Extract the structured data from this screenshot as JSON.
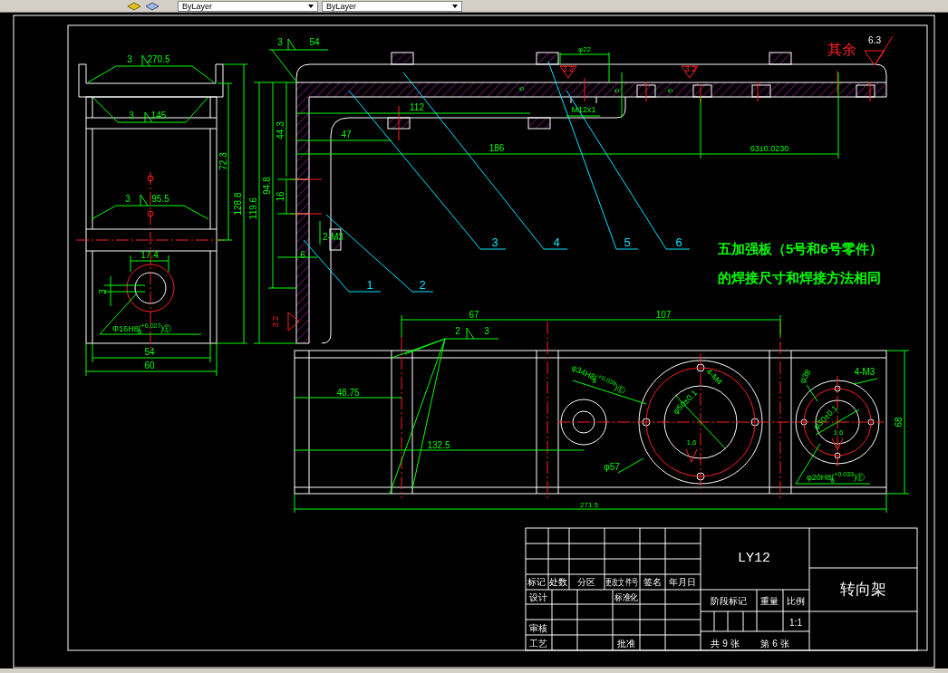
{
  "toolbar": {
    "dropdowns": [
      "ByLayer",
      "ByLayer"
    ]
  },
  "side_view": {
    "labels": [
      {
        "text": "3",
        "kind": "dimension"
      },
      {
        "text": "270.5",
        "kind": "dimension"
      },
      {
        "text": "3",
        "kind": "dimension"
      },
      {
        "text": "145",
        "kind": "dimension"
      },
      {
        "text": "3",
        "kind": "dimension"
      },
      {
        "text": "95.5",
        "kind": "dimension"
      },
      {
        "text": "72.3",
        "kind": "dimension"
      },
      {
        "text": "128.8",
        "kind": "dimension"
      },
      {
        "text": "17.4",
        "kind": "dimension"
      },
      {
        "text": "3",
        "kind": "dimension"
      },
      {
        "text": "Φ16H8(",
        "upper": "+0.027",
        "lower": "0",
        "suffix": ")Ⓔ",
        "kind": "dimension"
      },
      {
        "text": "54",
        "kind": "dimension"
      },
      {
        "text": "60",
        "kind": "dimension"
      }
    ]
  },
  "front_view": {
    "labels": [
      {
        "text": "3",
        "kind": "dimension"
      },
      {
        "text": "54",
        "kind": "dimension"
      },
      {
        "text": "44.3",
        "kind": "dimension"
      },
      {
        "text": "94.8",
        "kind": "dimension"
      },
      {
        "text": "119.6",
        "kind": "dimension"
      },
      {
        "text": "16",
        "kind": "dimension"
      },
      {
        "text": "112",
        "kind": "dimension"
      },
      {
        "text": "47",
        "kind": "dimension"
      },
      {
        "text": "186",
        "kind": "dimension"
      },
      {
        "text": "63±0.0230",
        "kind": "dimension"
      },
      {
        "text": "2-M3",
        "kind": "dimension"
      },
      {
        "text": "6",
        "kind": "dimension"
      },
      {
        "text": "3.2",
        "kind": "roughness"
      },
      {
        "text": "φ22",
        "kind": "dimension"
      },
      {
        "text": "3.2",
        "kind": "roughness"
      },
      {
        "text": "3.2",
        "kind": "roughness"
      },
      {
        "text": "6",
        "kind": "dimension"
      },
      {
        "text": "5",
        "kind": "dimension"
      },
      {
        "text": "5",
        "kind": "dimension"
      },
      {
        "text": "M12x1",
        "kind": "dimension"
      },
      {
        "text": "其余",
        "kind": "remark"
      },
      {
        "text": "6.3",
        "kind": "symbol"
      }
    ],
    "part_numbers": [
      "1",
      "2",
      "3",
      "4",
      "5",
      "6"
    ],
    "note": [
      "五加强板（5号和6号零件）",
      "的焊接尺寸和焊接方法相同"
    ]
  },
  "bottom_view": {
    "labels": [
      {
        "text": "67",
        "kind": "dimension"
      },
      {
        "text": "107",
        "kind": "dimension"
      },
      {
        "text": "2",
        "kind": "dimension"
      },
      {
        "text": "3",
        "kind": "dimension"
      },
      {
        "text": "48.75",
        "kind": "dimension"
      },
      {
        "text": "132.5",
        "kind": "dimension"
      },
      {
        "text": "φ34H8(",
        "upper": "+0.039",
        "lower": "0",
        "suffix": ")Ⓔ",
        "kind": "dimension"
      },
      {
        "text": "4-M4",
        "kind": "dimension"
      },
      {
        "text": "φ50±0.1",
        "kind": "dimension"
      },
      {
        "text": "1.6",
        "kind": "dimension"
      },
      {
        "text": "φ57",
        "kind": "dimension"
      },
      {
        "text": "φ38",
        "kind": "dimension"
      },
      {
        "text": "4-M3",
        "kind": "dimension"
      },
      {
        "text": "φ30±0.1",
        "kind": "dimension"
      },
      {
        "text": "1.6",
        "kind": "dimension"
      },
      {
        "text": "φ20H8(",
        "upper": "+0.033",
        "lower": "0",
        "suffix": ")Ⓔ",
        "kind": "dimension"
      },
      {
        "text": "68",
        "kind": "dimension"
      },
      {
        "text": "271.5",
        "kind": "dimension"
      }
    ]
  },
  "title_block": {
    "material": "LY12",
    "part_name": "转向架",
    "cells": [
      "标记",
      "处数",
      "分区",
      "更改文件号",
      "签名",
      "年月日",
      "设计",
      "标准化",
      "审核",
      "工艺",
      "批准",
      "阶段标记",
      "重量",
      "比例",
      "1:1",
      "共 9 张",
      "第 6 张"
    ]
  }
}
